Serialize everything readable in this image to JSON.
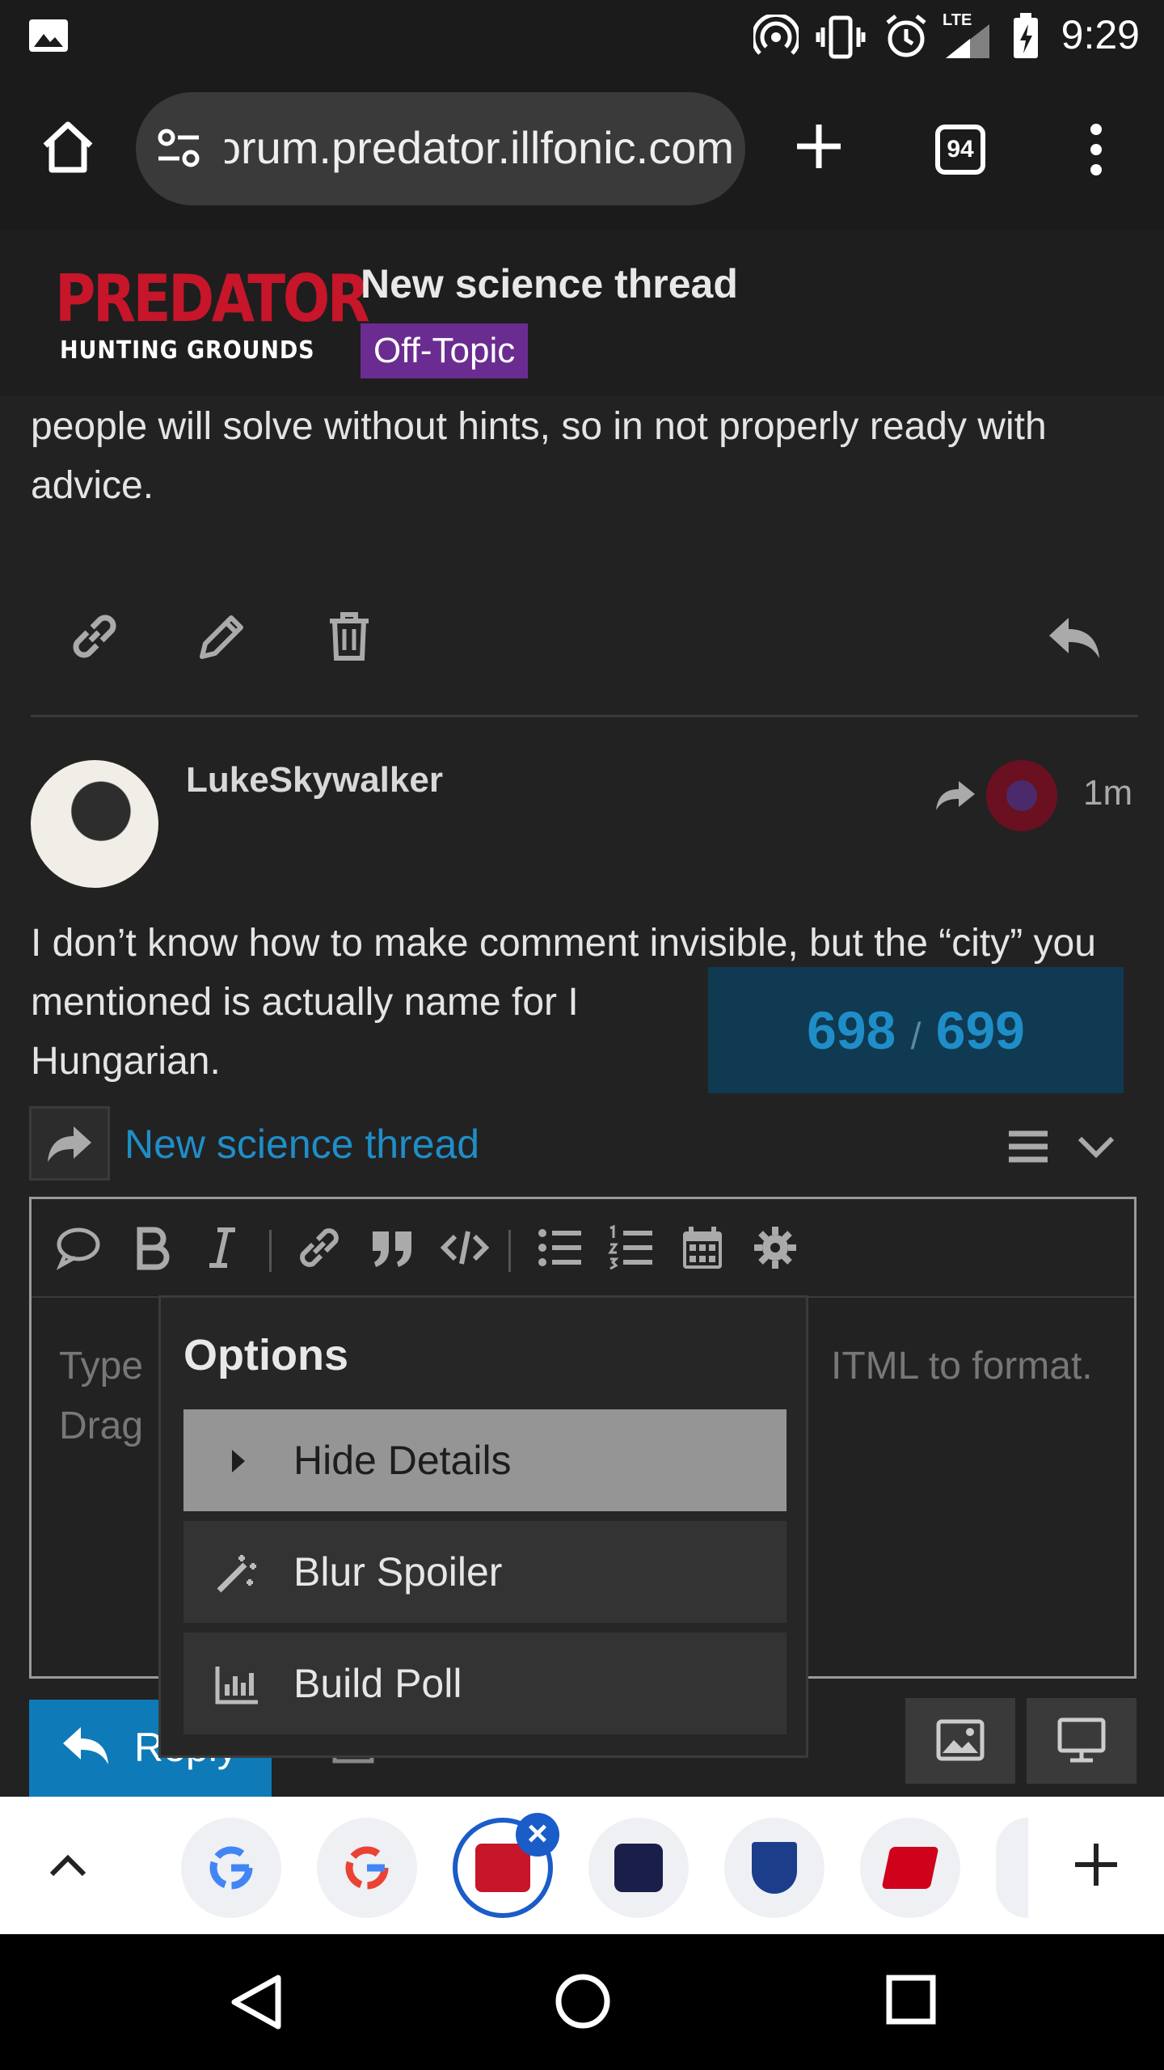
{
  "status_bar": {
    "time": "9:29",
    "network": "LTE"
  },
  "browser": {
    "url": "forum.predator.illfonic.com",
    "tab_count": "94",
    "icons": [
      "home-icon",
      "site-settings-icon",
      "new-tab-icon",
      "tab-switcher-icon",
      "overflow-menu-icon"
    ]
  },
  "site_header": {
    "logo_title": "PREDATOR",
    "logo_subtitle": "HUNTING GROUNDS",
    "thread_title": "New science thread",
    "category": "Off-Topic",
    "category_color": "#6a2c91"
  },
  "previous_post": {
    "text": "either because that's too much of a give away. I always hope people will solve without hints, so in not properly ready with advice."
  },
  "post": {
    "username": "LukeSkywalker",
    "time": "1m",
    "text": "I don’t know how to make comment invisible, but the “city” you mentioned is actually name for I",
    "text_end": "Hungarian."
  },
  "progress": {
    "current": "698",
    "separator": "/",
    "total": "699"
  },
  "composer": {
    "reply_to": "New science thread",
    "placeholder_line1": "Type",
    "placeholder_line1_end": "ITML to format.",
    "placeholder_line2": "Drag",
    "reply_label": "Reply"
  },
  "options_menu": {
    "title": "Options",
    "items": [
      {
        "label": "Hide Details",
        "icon": "caret-right-icon"
      },
      {
        "label": "Blur Spoiler",
        "icon": "magic-wand-icon"
      },
      {
        "label": "Build Poll",
        "icon": "chart-icon"
      }
    ]
  },
  "colors": {
    "accent": "#1f8ec8",
    "reply_button": "#0e7bb8",
    "tab_active": "#1a5cc8"
  }
}
